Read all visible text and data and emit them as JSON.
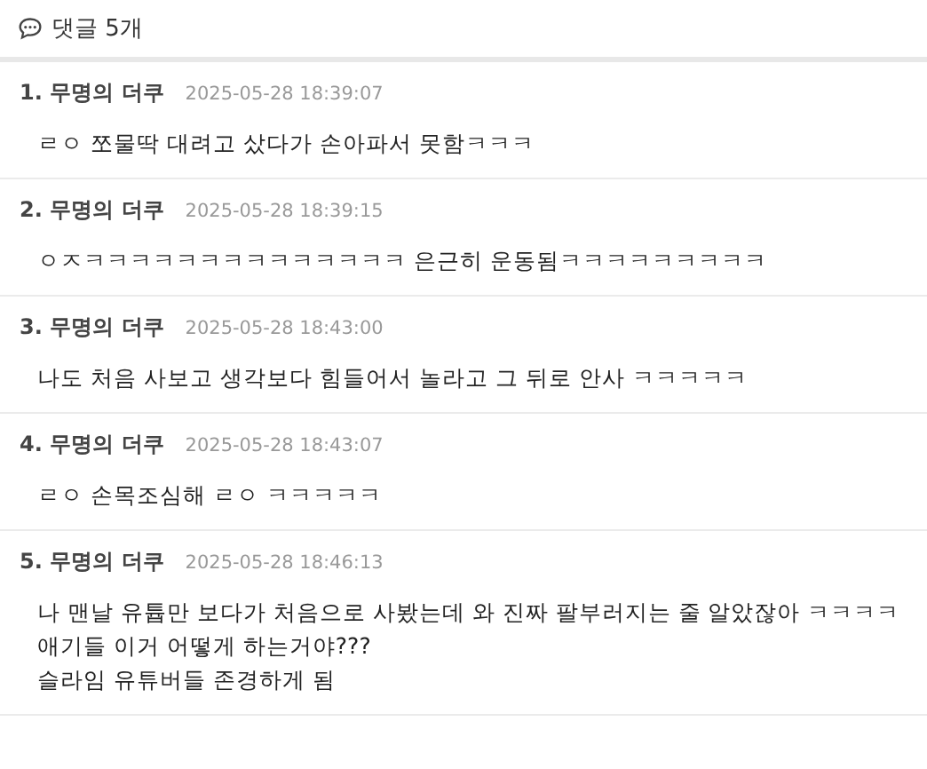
{
  "header": {
    "title": "댓글 5개"
  },
  "comments": [
    {
      "index": "1.",
      "author": "무명의 더쿠",
      "time": "2025-05-28 18:39:07",
      "lines": [
        "ㄹㅇ 쪼물딱 대려고 샀다가 손아파서 못함ㅋㅋㅋ"
      ]
    },
    {
      "index": "2.",
      "author": "무명의 더쿠",
      "time": "2025-05-28 18:39:15",
      "lines": [
        "ㅇㅈㅋㅋㅋㅋㅋㅋㅋㅋㅋㅋㅋㅋㅋㅋ 은근히 운동됨ㅋㅋㅋㅋㅋㅋㅋㅋㅋ"
      ]
    },
    {
      "index": "3.",
      "author": "무명의 더쿠",
      "time": "2025-05-28 18:43:00",
      "lines": [
        "나도 처음 사보고 생각보다 힘들어서 놀라고 그 뒤로 안사 ㅋㅋㅋㅋㅋ"
      ]
    },
    {
      "index": "4.",
      "author": "무명의 더쿠",
      "time": "2025-05-28 18:43:07",
      "lines": [
        "ㄹㅇ 손목조심해 ㄹㅇ ㅋㅋㅋㅋㅋ"
      ]
    },
    {
      "index": "5.",
      "author": "무명의 더쿠",
      "time": "2025-05-28 18:46:13",
      "lines": [
        "나 맨날 유튭만 보다가 처음으로 사봤는데 와 진짜 팔부러지는 줄 알았잖아 ㅋㅋㅋㅋ 애기들 이거 어떻게 하는거야???",
        "슬라임 유튜버들 존경하게 됨"
      ]
    }
  ]
}
